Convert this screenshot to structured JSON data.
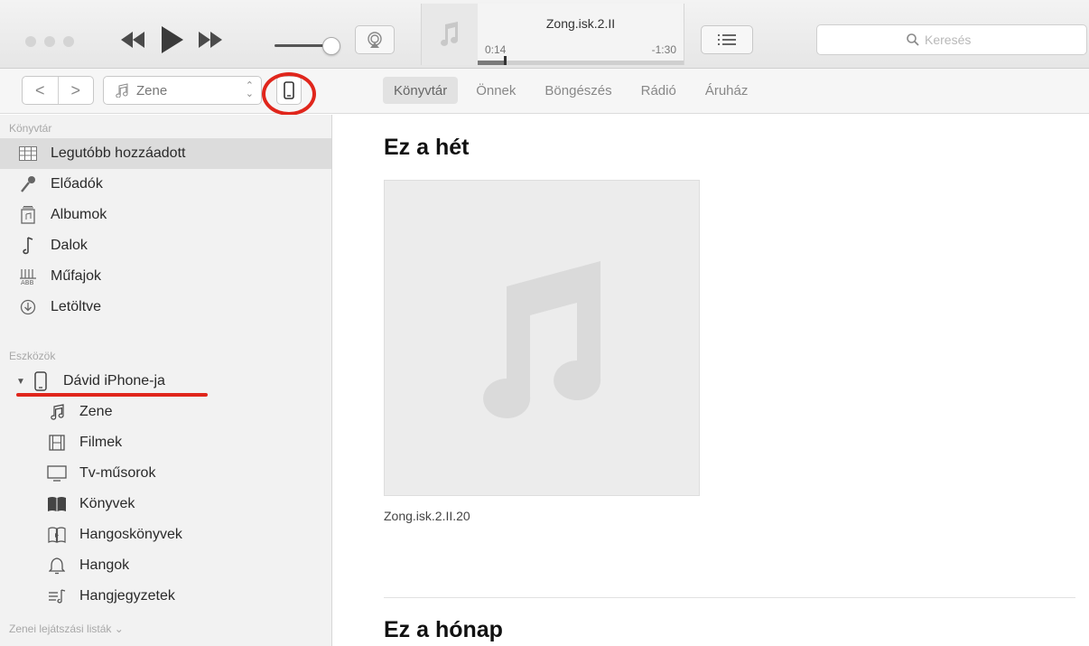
{
  "window": {
    "traffic_lights": [
      "close",
      "minimize",
      "zoom"
    ]
  },
  "player": {
    "song_title": "Zong.isk.2.II",
    "elapsed": "0:14",
    "remaining": "-1:30",
    "progress_fraction": 0.13,
    "volume_fraction": 0.85
  },
  "search": {
    "placeholder": "Keresés"
  },
  "toolbar": {
    "back_label": "<",
    "forward_label": ">",
    "media_kind": "Zene",
    "tabs": [
      {
        "label": "Könyvtár",
        "active": true
      },
      {
        "label": "Önnek",
        "active": false
      },
      {
        "label": "Böngészés",
        "active": false
      },
      {
        "label": "Rádió",
        "active": false
      },
      {
        "label": "Áruház",
        "active": false
      }
    ]
  },
  "sidebar": {
    "library_header": "Könyvtár",
    "library_items": [
      {
        "label": "Legutóbb hozzáadott",
        "icon": "grid-icon",
        "selected": true
      },
      {
        "label": "Előadók",
        "icon": "microphone-icon",
        "selected": false
      },
      {
        "label": "Albumok",
        "icon": "album-icon",
        "selected": false
      },
      {
        "label": "Dalok",
        "icon": "note-icon",
        "selected": false
      },
      {
        "label": "Műfajok",
        "icon": "genre-icon",
        "selected": false
      },
      {
        "label": "Letöltve",
        "icon": "download-icon",
        "selected": false
      }
    ],
    "devices_header": "Eszközök",
    "device": {
      "label": "Dávid iPhone-ja",
      "icon": "iphone-icon",
      "expanded": true
    },
    "device_items": [
      {
        "label": "Zene",
        "icon": "music-note-icon"
      },
      {
        "label": "Filmek",
        "icon": "film-icon"
      },
      {
        "label": "Tv-műsorok",
        "icon": "tv-icon"
      },
      {
        "label": "Könyvek",
        "icon": "book-icon"
      },
      {
        "label": "Hangoskönyvek",
        "icon": "audiobook-icon"
      },
      {
        "label": "Hangok",
        "icon": "bell-icon"
      },
      {
        "label": "Hangjegyzetek",
        "icon": "voice-memo-icon"
      }
    ],
    "playlists_header": "Zenei lejátszási listák ⌄"
  },
  "main": {
    "week_heading": "Ez a hét",
    "album_title": "Zong.isk.2.II.20",
    "month_heading": "Ez a hónap"
  },
  "colors": {
    "annotation_red": "#e0261c",
    "sidebar_bg": "#f2f2f2",
    "selected_row": "#dcdcdc"
  }
}
